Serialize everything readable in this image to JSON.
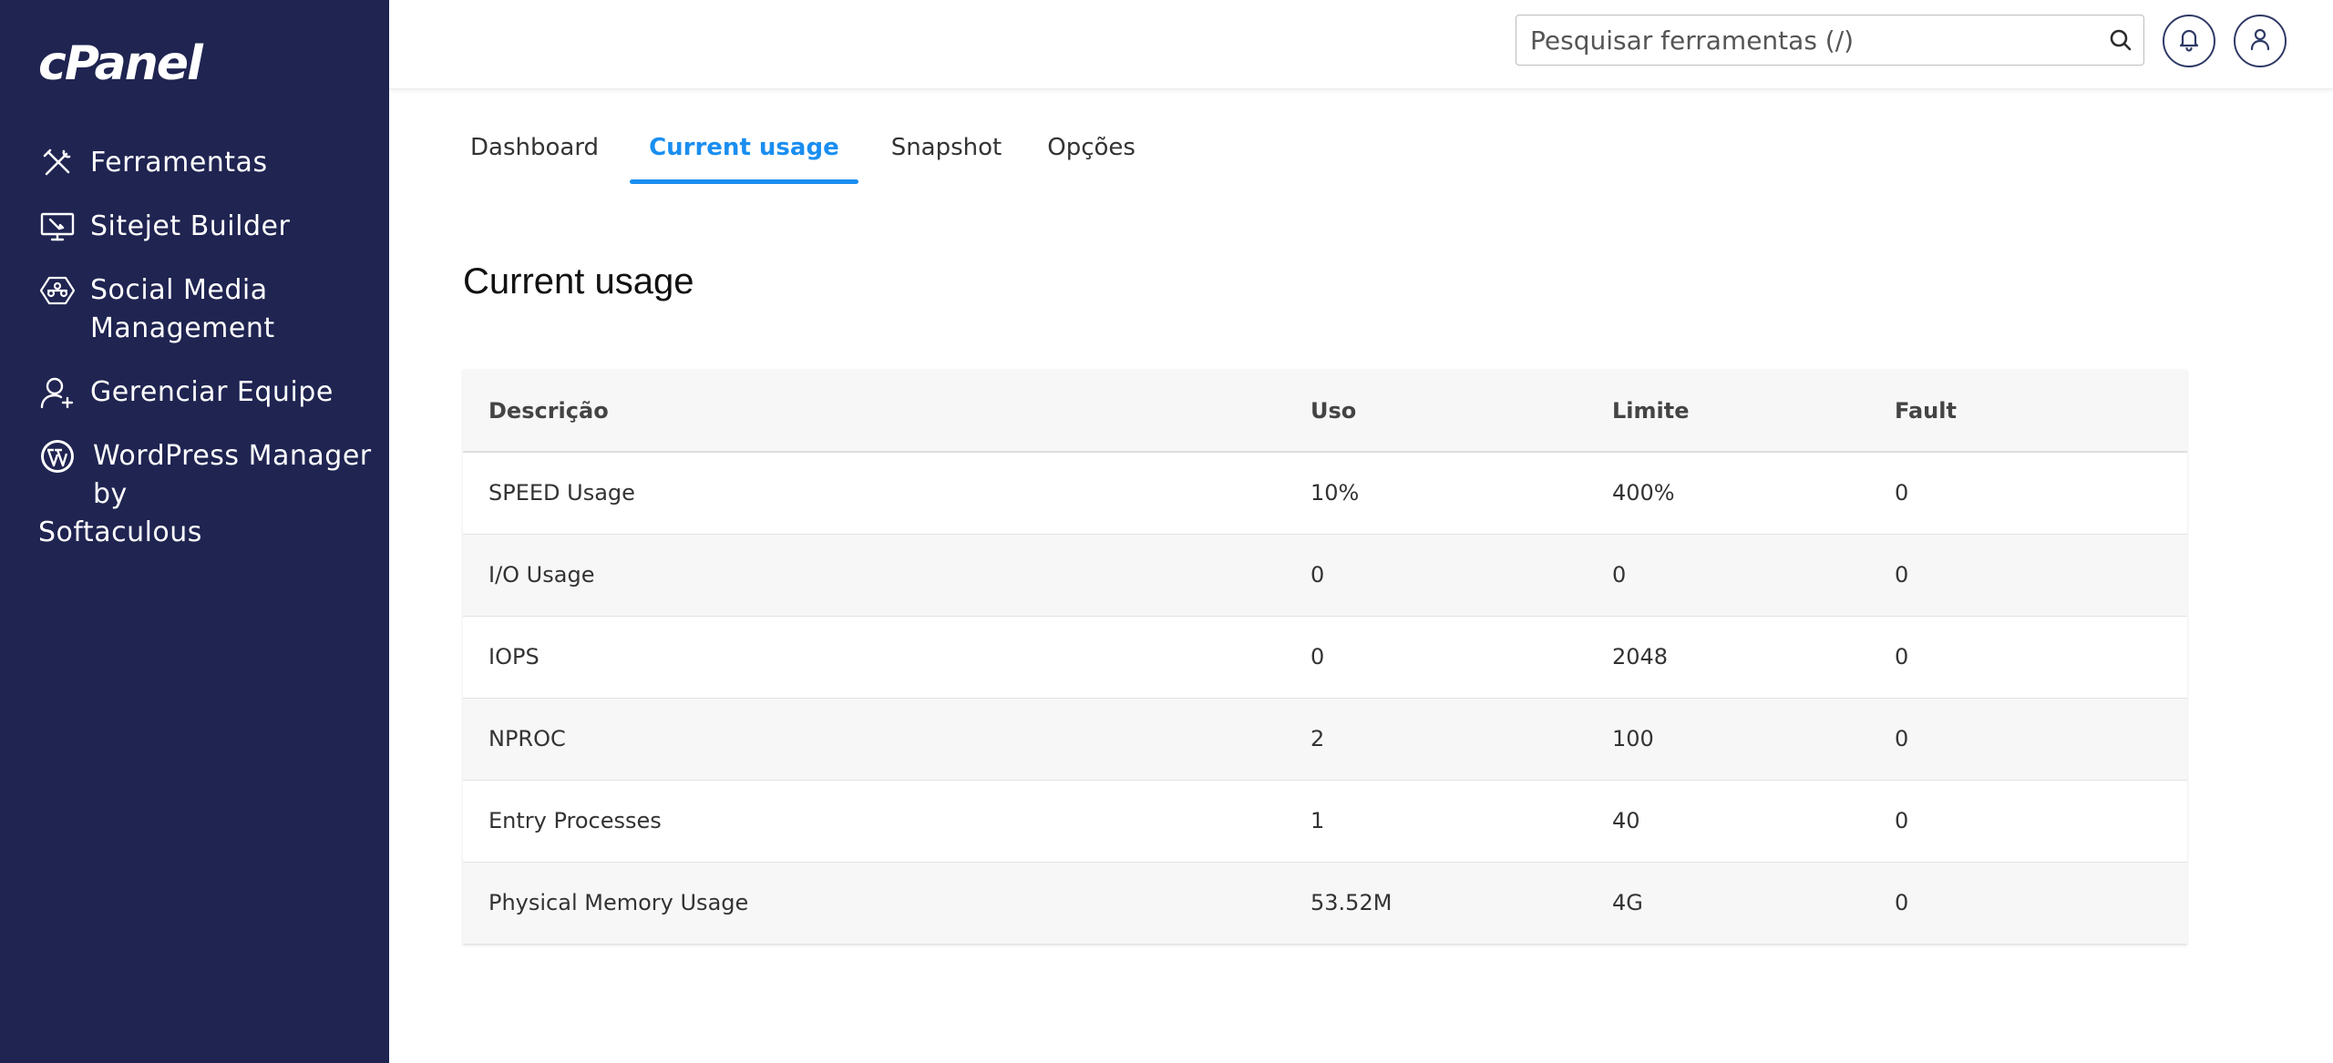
{
  "app": {
    "logo": "cPanel"
  },
  "sidebar": {
    "items": [
      {
        "label": "Ferramentas",
        "icon": "tools-icon"
      },
      {
        "label": "Sitejet Builder",
        "icon": "monitor-builder-icon"
      },
      {
        "label_line1": "Social Media",
        "label_line2": "Management",
        "icon": "social-media-icon"
      },
      {
        "label": "Gerenciar Equipe",
        "icon": "team-icon"
      },
      {
        "label_line1": "WordPress",
        "label_line2": "Manager by",
        "label_line3": "Softaculous",
        "icon": "wordpress-icon"
      }
    ]
  },
  "header": {
    "search_placeholder": "Pesquisar ferramentas (/)"
  },
  "tabs": [
    {
      "label": "Dashboard",
      "active": false
    },
    {
      "label": "Current usage",
      "active": true
    },
    {
      "label": "Snapshot",
      "active": false
    },
    {
      "label": "Opções",
      "active": false
    }
  ],
  "main": {
    "title": "Current usage",
    "table": {
      "headers": [
        "Descrição",
        "Uso",
        "Limite",
        "Fault"
      ],
      "rows": [
        [
          "SPEED Usage",
          "10%",
          "400%",
          "0"
        ],
        [
          "I/O Usage",
          "0",
          "0",
          "0"
        ],
        [
          "IOPS",
          "0",
          "2048",
          "0"
        ],
        [
          "NPROC",
          "2",
          "100",
          "0"
        ],
        [
          "Entry Processes",
          "1",
          "40",
          "0"
        ],
        [
          "Physical Memory Usage",
          "53.52M",
          "4G",
          "0"
        ]
      ]
    }
  },
  "colors": {
    "sidebar_bg": "#1f2451",
    "accent": "#1a8ef0"
  }
}
